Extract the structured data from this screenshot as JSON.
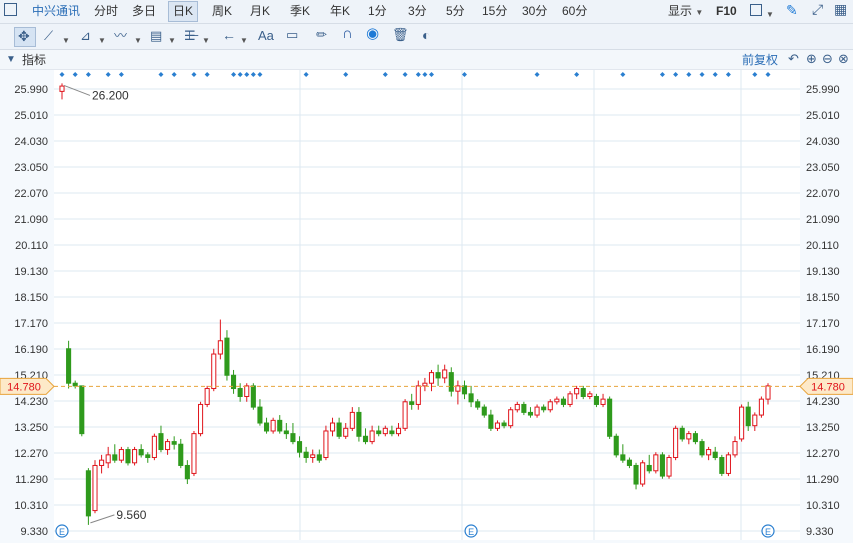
{
  "toolbar1": {
    "stock_name": "中兴通讯",
    "periods": [
      "分时",
      "多日",
      "日K",
      "周K",
      "月K",
      "季K",
      "年K",
      "1分",
      "3分",
      "5分",
      "15分",
      "30分",
      "60分"
    ],
    "active_period": "日K",
    "display_label": "显示",
    "f10_label": "F10"
  },
  "toolbar2": {
    "text_tool_label": "Aa"
  },
  "indicator_bar": {
    "label": "指标",
    "adjust_label": "前复权"
  },
  "chart_data": {
    "type": "candlestick",
    "y_ticks": [
      25.99,
      25.01,
      24.03,
      23.05,
      22.07,
      21.09,
      20.11,
      19.13,
      18.15,
      17.17,
      16.19,
      15.21,
      14.23,
      13.25,
      12.27,
      11.29,
      10.31,
      9.33
    ],
    "y_tick_labels": [
      "25.990",
      "25.010",
      "24.030",
      "23.050",
      "22.070",
      "21.090",
      "20.110",
      "19.130",
      "18.150",
      "17.170",
      "16.190",
      "15.210",
      "14.230",
      "13.250",
      "12.270",
      "11.290",
      "10.310",
      "9.330"
    ],
    "ylim": [
      9.33,
      26.4
    ],
    "current_price": 14.78,
    "current_price_label": "14.780",
    "max_label": "26.200",
    "min_label": "9.560",
    "colors": {
      "up": "#e0151c",
      "down": "#2f9a1c",
      "current": "#e8a43c",
      "grid": "#dde8f2"
    },
    "event_marker_label": "E",
    "candles": [
      [
        25.9,
        26.2,
        25.6,
        26.1
      ],
      [
        16.2,
        16.5,
        14.7,
        14.9
      ],
      [
        14.9,
        15.0,
        14.7,
        14.8
      ],
      [
        14.8,
        14.8,
        12.9,
        13.0
      ],
      [
        11.6,
        11.7,
        9.56,
        9.9
      ],
      [
        10.1,
        12.0,
        10.0,
        11.8
      ],
      [
        11.8,
        12.2,
        11.5,
        12.0
      ],
      [
        11.9,
        12.5,
        11.7,
        12.2
      ],
      [
        12.2,
        12.6,
        11.9,
        12.0
      ],
      [
        12.0,
        12.5,
        11.9,
        12.4
      ],
      [
        12.4,
        12.5,
        11.8,
        11.9
      ],
      [
        11.9,
        12.5,
        11.8,
        12.4
      ],
      [
        12.4,
        12.6,
        12.1,
        12.2
      ],
      [
        12.2,
        12.3,
        11.9,
        12.1
      ],
      [
        12.1,
        13.0,
        12.0,
        12.9
      ],
      [
        13.0,
        13.3,
        12.3,
        12.4
      ],
      [
        12.4,
        12.8,
        12.2,
        12.7
      ],
      [
        12.7,
        12.9,
        12.4,
        12.6
      ],
      [
        12.6,
        12.8,
        11.7,
        11.8
      ],
      [
        11.8,
        12.0,
        11.1,
        11.3
      ],
      [
        11.5,
        13.1,
        11.4,
        13.0
      ],
      [
        13.0,
        14.2,
        12.9,
        14.1
      ],
      [
        14.1,
        14.8,
        14.0,
        14.7
      ],
      [
        14.7,
        16.2,
        14.6,
        16.0
      ],
      [
        16.0,
        17.3,
        15.8,
        16.5
      ],
      [
        16.6,
        16.9,
        15.0,
        15.2
      ],
      [
        15.2,
        15.4,
        14.5,
        14.7
      ],
      [
        14.7,
        14.9,
        14.2,
        14.4
      ],
      [
        14.4,
        14.9,
        14.2,
        14.8
      ],
      [
        14.8,
        14.9,
        13.9,
        14.0
      ],
      [
        14.0,
        14.3,
        13.3,
        13.4
      ],
      [
        13.4,
        13.6,
        13.0,
        13.1
      ],
      [
        13.1,
        13.6,
        13.0,
        13.5
      ],
      [
        13.5,
        13.7,
        13.0,
        13.1
      ],
      [
        13.1,
        13.4,
        12.8,
        13.0
      ],
      [
        13.0,
        13.4,
        12.6,
        12.7
      ],
      [
        12.7,
        12.9,
        12.1,
        12.3
      ],
      [
        12.3,
        12.5,
        11.9,
        12.1
      ],
      [
        12.1,
        12.4,
        11.9,
        12.2
      ],
      [
        12.2,
        12.4,
        11.9,
        12.0
      ],
      [
        12.1,
        13.3,
        12.0,
        13.1
      ],
      [
        13.1,
        13.6,
        12.9,
        13.4
      ],
      [
        13.4,
        13.6,
        12.8,
        12.9
      ],
      [
        12.9,
        13.4,
        12.8,
        13.2
      ],
      [
        13.2,
        14.0,
        13.1,
        13.8
      ],
      [
        13.8,
        14.0,
        12.7,
        12.9
      ],
      [
        12.9,
        13.2,
        12.6,
        12.7
      ],
      [
        12.7,
        13.3,
        12.6,
        13.1
      ],
      [
        13.1,
        13.3,
        12.9,
        13.0
      ],
      [
        13.0,
        13.3,
        12.9,
        13.2
      ],
      [
        13.1,
        13.3,
        12.9,
        13.0
      ],
      [
        13.0,
        13.4,
        12.9,
        13.2
      ],
      [
        13.2,
        14.3,
        13.1,
        14.2
      ],
      [
        14.2,
        14.5,
        13.9,
        14.1
      ],
      [
        14.1,
        15.0,
        13.9,
        14.8
      ],
      [
        14.8,
        15.1,
        14.6,
        14.9
      ],
      [
        14.9,
        15.4,
        14.6,
        15.3
      ],
      [
        15.3,
        15.6,
        14.8,
        15.1
      ],
      [
        15.1,
        15.6,
        14.9,
        15.4
      ],
      [
        15.3,
        15.5,
        14.4,
        14.6
      ],
      [
        14.6,
        15.0,
        14.1,
        14.8
      ],
      [
        14.8,
        15.0,
        14.3,
        14.5
      ],
      [
        14.5,
        14.8,
        14.0,
        14.2
      ],
      [
        14.2,
        14.3,
        13.9,
        14.0
      ],
      [
        14.0,
        14.1,
        13.6,
        13.7
      ],
      [
        13.7,
        13.9,
        13.1,
        13.2
      ],
      [
        13.2,
        13.5,
        13.1,
        13.4
      ],
      [
        13.4,
        13.5,
        13.2,
        13.3
      ],
      [
        13.3,
        14.0,
        13.2,
        13.9
      ],
      [
        13.9,
        14.2,
        13.8,
        14.1
      ],
      [
        14.1,
        14.2,
        13.7,
        13.8
      ],
      [
        13.8,
        14.0,
        13.6,
        13.7
      ],
      [
        13.7,
        14.1,
        13.6,
        14.0
      ],
      [
        14.0,
        14.1,
        13.8,
        13.9
      ],
      [
        13.9,
        14.3,
        13.8,
        14.2
      ],
      [
        14.2,
        14.4,
        14.1,
        14.3
      ],
      [
        14.3,
        14.4,
        14.0,
        14.1
      ],
      [
        14.1,
        14.6,
        14.0,
        14.5
      ],
      [
        14.5,
        14.8,
        14.3,
        14.7
      ],
      [
        14.7,
        14.8,
        14.3,
        14.4
      ],
      [
        14.4,
        14.6,
        14.3,
        14.5
      ],
      [
        14.4,
        14.5,
        14.0,
        14.1
      ],
      [
        14.1,
        14.5,
        14.0,
        14.3
      ],
      [
        14.3,
        14.4,
        12.8,
        12.9
      ],
      [
        12.9,
        13.0,
        12.1,
        12.2
      ],
      [
        12.2,
        12.6,
        11.9,
        12.0
      ],
      [
        12.0,
        12.1,
        11.7,
        11.8
      ],
      [
        11.8,
        11.9,
        10.9,
        11.1
      ],
      [
        11.1,
        12.0,
        11.0,
        11.9
      ],
      [
        11.8,
        12.2,
        11.5,
        11.6
      ],
      [
        11.6,
        12.3,
        11.5,
        12.2
      ],
      [
        12.2,
        12.3,
        11.3,
        11.4
      ],
      [
        11.4,
        12.2,
        11.3,
        12.1
      ],
      [
        12.1,
        13.3,
        12.0,
        13.2
      ],
      [
        13.2,
        13.3,
        12.7,
        12.8
      ],
      [
        12.8,
        13.1,
        12.6,
        13.0
      ],
      [
        13.0,
        13.1,
        12.6,
        12.7
      ],
      [
        12.7,
        12.8,
        12.1,
        12.2
      ],
      [
        12.2,
        12.5,
        12.0,
        12.4
      ],
      [
        12.3,
        12.5,
        12.0,
        12.1
      ],
      [
        12.1,
        12.2,
        11.4,
        11.5
      ],
      [
        11.5,
        12.3,
        11.4,
        12.2
      ],
      [
        12.2,
        12.9,
        12.1,
        12.7
      ],
      [
        12.8,
        14.1,
        12.7,
        14.0
      ],
      [
        14.0,
        14.2,
        13.1,
        13.3
      ],
      [
        13.3,
        13.8,
        13.1,
        13.7
      ],
      [
        13.7,
        14.4,
        13.6,
        14.3
      ],
      [
        14.3,
        14.9,
        14.1,
        14.8
      ]
    ],
    "event_markers": [
      0,
      62,
      107
    ]
  }
}
